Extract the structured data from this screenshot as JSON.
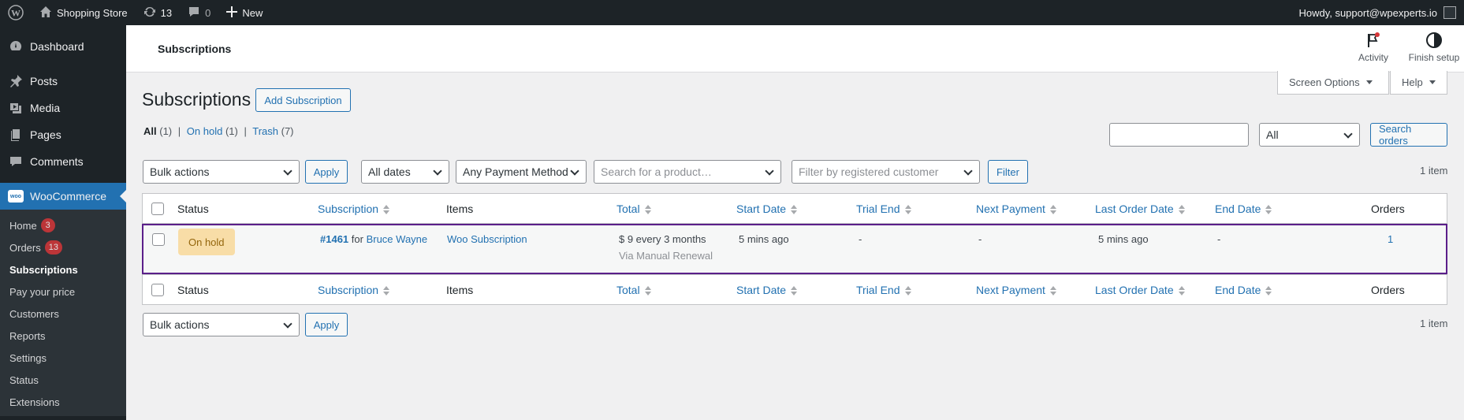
{
  "adminbar": {
    "site_name": "Shopping Store",
    "updates_count": "13",
    "comments_count": "0",
    "new_label": "New",
    "howdy": "Howdy, support@wpexperts.io"
  },
  "sidebar": {
    "items": [
      {
        "label": "Dashboard",
        "icon": "dashboard-icon"
      },
      {
        "label": "Posts",
        "icon": "pin-icon"
      },
      {
        "label": "Media",
        "icon": "media-icon"
      },
      {
        "label": "Pages",
        "icon": "pages-icon"
      },
      {
        "label": "Comments",
        "icon": "comment-icon"
      }
    ],
    "woo_label": "WooCommerce",
    "woo_logo_text": "woo",
    "submenu": [
      {
        "label": "Home",
        "badge": "3"
      },
      {
        "label": "Orders",
        "badge": "13"
      },
      {
        "label": "Subscriptions"
      },
      {
        "label": "Pay your price"
      },
      {
        "label": "Customers"
      },
      {
        "label": "Reports"
      },
      {
        "label": "Settings"
      },
      {
        "label": "Status"
      },
      {
        "label": "Extensions"
      }
    ]
  },
  "header": {
    "title": "Subscriptions",
    "activity_label": "Activity",
    "finish_setup_label": "Finish setup"
  },
  "screen_options_label": "Screen Options",
  "help_label": "Help",
  "page": {
    "heading": "Subscriptions",
    "add_button": "Add Subscription"
  },
  "views": {
    "all_label": "All",
    "all_count": "(1)",
    "onhold_label": "On hold",
    "onhold_count": "(1)",
    "trash_label": "Trash",
    "trash_count": "(7)",
    "sep": "|"
  },
  "search": {
    "value": "",
    "status_select": "All",
    "button": "Search orders"
  },
  "filters": {
    "bulk_actions": "Bulk actions",
    "apply": "Apply",
    "dates": "All dates",
    "payment_method": "Any Payment Method",
    "product_placeholder": "Search for a product…",
    "customer_placeholder": "Filter by registered customer",
    "filter_button": "Filter"
  },
  "item_count": "1 item",
  "columns": {
    "status": "Status",
    "subscription": "Subscription",
    "items": "Items",
    "total": "Total",
    "start_date": "Start Date",
    "trial_end": "Trial End",
    "next_payment": "Next Payment",
    "last_order_date": "Last Order Date",
    "end_date": "End Date",
    "orders": "Orders"
  },
  "row": {
    "status": "On hold",
    "sub_id": "#1461",
    "for_text": "for",
    "customer": "Bruce Wayne",
    "item": "Woo Subscription",
    "total": "$ 9 every 3 months",
    "via": "Via Manual Renewal",
    "start_date": "5 mins ago",
    "trial_end": "-",
    "next_payment": "-",
    "last_order_date": "5 mins ago",
    "end_date": "-",
    "orders": "1"
  },
  "colors": {
    "accent": "#2271b1",
    "sidebar_bg": "#1d2327",
    "onhold_bg": "#f8dda7",
    "highlight_border": "#5b1f8a"
  }
}
